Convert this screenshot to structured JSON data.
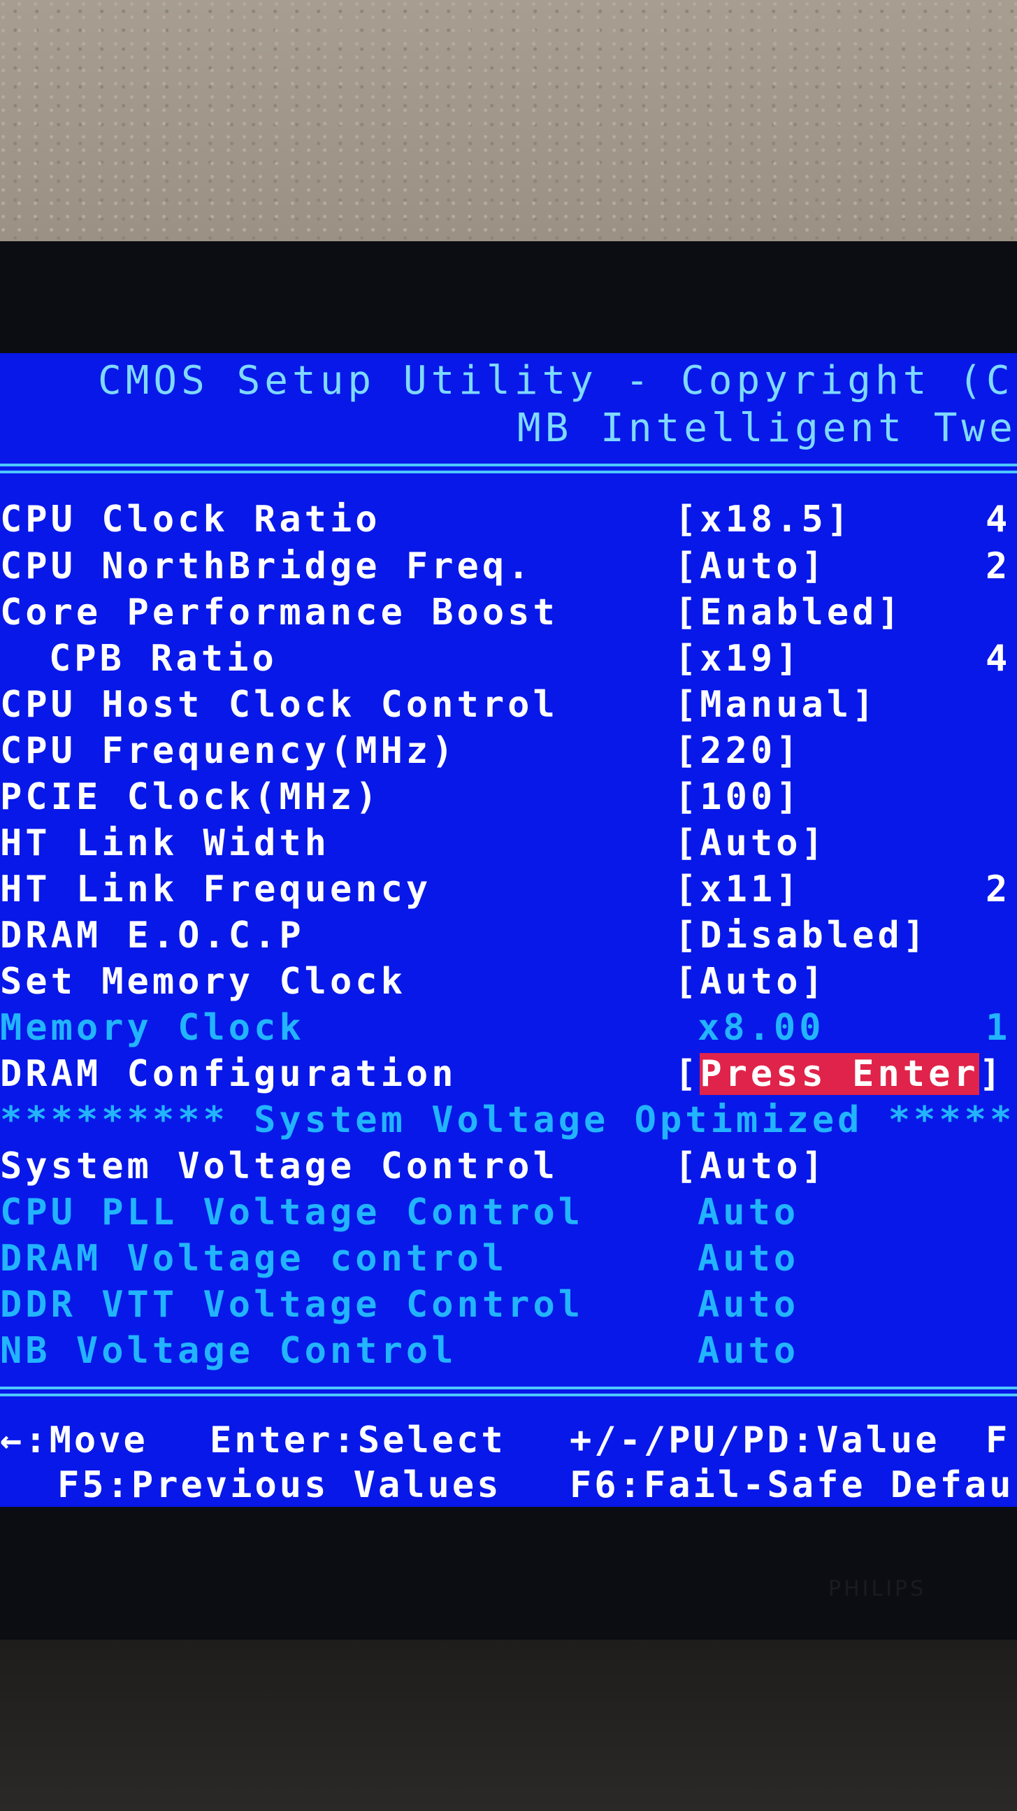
{
  "header": {
    "line1": "CMOS Setup Utility - Copyright (C)",
    "line2": "MB Intelligent Twea"
  },
  "settings": [
    {
      "label": "CPU Clock Ratio",
      "value": "[x18.5]",
      "extra": "4"
    },
    {
      "label": "CPU NorthBridge Freq.",
      "value": "[Auto]",
      "extra": "2"
    },
    {
      "label": "Core Performance Boost",
      "value": "[Enabled]",
      "extra": ""
    },
    {
      "label": "CPB Ratio",
      "value": "[x19]",
      "extra": "4"
    },
    {
      "label": "CPU Host Clock Control",
      "value": "[Manual]",
      "extra": ""
    },
    {
      "label": "CPU Frequency(MHz)",
      "value": "[220]",
      "extra": ""
    },
    {
      "label": "PCIE Clock(MHz)",
      "value": "[100]",
      "extra": ""
    },
    {
      "label": "HT Link Width",
      "value": "[Auto]",
      "extra": ""
    },
    {
      "label": "HT Link Frequency",
      "value": "[x11]",
      "extra": "2"
    },
    {
      "label": "DRAM E.O.C.P",
      "value": "[Disabled]",
      "extra": ""
    },
    {
      "label": "Set Memory Clock",
      "value": "[Auto]",
      "extra": ""
    },
    {
      "label": "Memory Clock",
      "value": "x8.00",
      "extra": "1"
    },
    {
      "label": "DRAM Configuration",
      "value_open": "[",
      "value_highlight": "Press Enter",
      "value_close": "]",
      "extra": ""
    }
  ],
  "voltage_section": {
    "title": "********* System Voltage Optimized ******"
  },
  "voltage_settings": [
    {
      "label": "System Voltage Control",
      "value": "[Auto]"
    },
    {
      "label": "CPU PLL Voltage Control",
      "value": "Auto"
    },
    {
      "label": "DRAM Voltage control",
      "value": "Auto"
    },
    {
      "label": "DDR VTT Voltage Control",
      "value": "Auto"
    },
    {
      "label": "NB Voltage Control",
      "value": "Auto"
    }
  ],
  "help": {
    "move": "←:Move",
    "select": "Enter:Select",
    "value": "+/-/PU/PD:Value",
    "extra": "F",
    "prev": "F5:Previous Values",
    "failsafe": "F6:Fail-Safe Defau"
  },
  "colors": {
    "screen_bg": "#0818e8",
    "header_text": "#7fd9ff",
    "dim_text": "#22b4ff",
    "highlight_bg": "#e0234a"
  },
  "monitor_brand": "PHILIPS"
}
